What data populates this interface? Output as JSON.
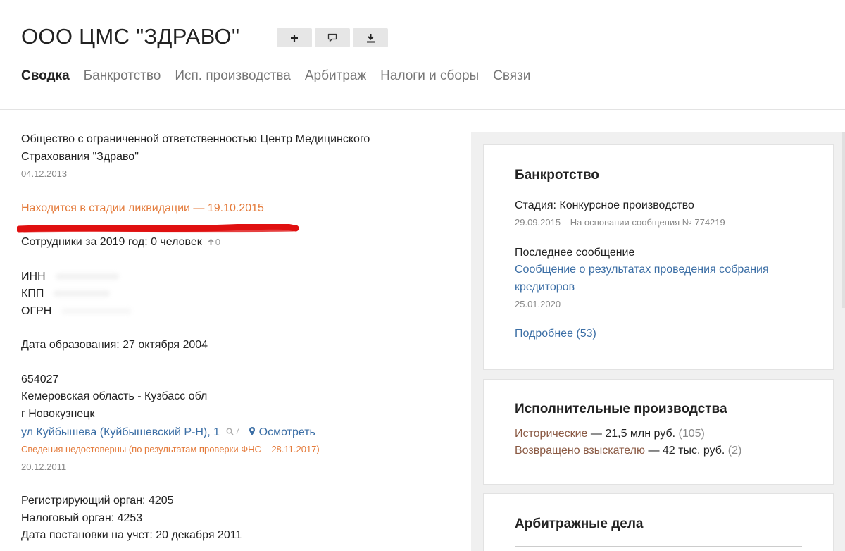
{
  "header": {
    "title": "ООО ЦМС \"ЗДРАВО\"",
    "actions": [
      {
        "icon": "plus-icon"
      },
      {
        "icon": "comment-icon"
      },
      {
        "icon": "download-icon"
      }
    ]
  },
  "tabs": [
    {
      "label": "Сводка",
      "active": true
    },
    {
      "label": "Банкротство"
    },
    {
      "label": "Исп. производства"
    },
    {
      "label": "Арбитраж"
    },
    {
      "label": "Налоги и сборы"
    },
    {
      "label": "Связи"
    }
  ],
  "summary": {
    "full_name": "Общество с ограниченной ответственностью Центр Медицинского Страхования \"Здраво\"",
    "full_name_date": "04.12.2013",
    "liquidation": "Находится в стадии ликвидации — 19.10.2015",
    "employees": "Сотрудники за 2019 год: 0 человек",
    "employees_delta": "0",
    "inn_label": "ИНН",
    "kpp_label": "КПП",
    "ogrn_label": "ОГРН",
    "founded": "Дата образования: 27 октября 2004",
    "address": {
      "postcode": "654027",
      "region": "Кемеровская область - Кузбасс обл",
      "city": "г Новокузнецк",
      "street": "ул Куйбышева (Куйбышевский Р-Н), 1",
      "search_count": "7",
      "map_label": "Осмотреть",
      "warning": "Сведения недостоверны (по результатам проверки ФНС – 28.11.2017)",
      "date": "20.12.2011"
    },
    "registrar": "Регистрирующий орган: 4205",
    "tax_authority": "Налоговый орган: 4253",
    "tax_registration": "Дата постановки на учет: 20 декабря 2011"
  },
  "bankruptcy": {
    "title": "Банкротство",
    "stage": "Стадия: Конкурсное производство",
    "stage_date": "29.09.2015",
    "stage_basis": "На основании сообщения № 774219",
    "last_message_label": "Последнее сообщение",
    "last_message_link": "Сообщение о результатах проведения собрания кредиторов",
    "last_message_date": "25.01.2020",
    "more_link": "Подробнее (53)"
  },
  "enforcement": {
    "title": "Исполнительные производства",
    "historical_label": "Исторические",
    "historical_value": " — 21,5 млн руб.",
    "historical_count": " (105)",
    "returned_label": "Возвращено взыскателю",
    "returned_value": " — 42 тыс. руб.",
    "returned_count": " (2)"
  },
  "arbitration": {
    "title": "Арбитражные дела"
  },
  "colors": {
    "accent_link": "#3b6ea5",
    "warning_orange": "#e47a3a",
    "annotation_red": "#e01010"
  }
}
